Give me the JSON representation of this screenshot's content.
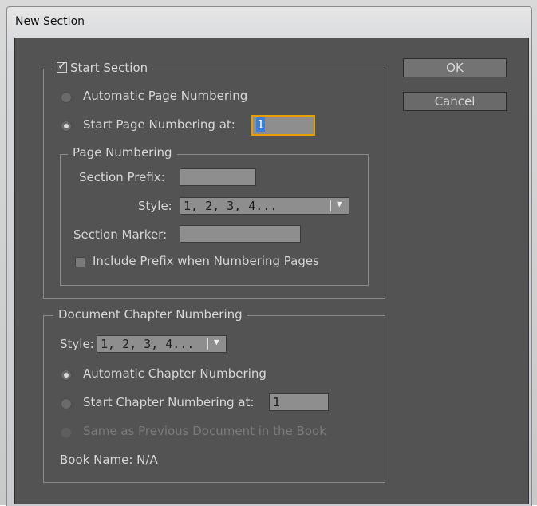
{
  "window": {
    "title": "New Section"
  },
  "start_section": {
    "label": "Start Section",
    "checked": true
  },
  "page_numbering_mode": {
    "automatic_label": "Automatic Page Numbering",
    "start_at_label": "Start Page Numbering at:",
    "start_at_value": "1",
    "selected": "start_at"
  },
  "page_numbering": {
    "group_label": "Page Numbering",
    "section_prefix_label": "Section Prefix:",
    "section_prefix_value": "",
    "style_label": "Style:",
    "style_value": "1, 2, 3, 4...",
    "section_marker_label": "Section Marker:",
    "section_marker_value": "",
    "include_prefix_label": "Include Prefix when Numbering Pages",
    "include_prefix_checked": false
  },
  "chapter_numbering": {
    "group_label": "Document Chapter Numbering",
    "style_label": "Style:",
    "style_value": "1, 2, 3, 4...",
    "automatic_label": "Automatic Chapter Numbering",
    "start_at_label": "Start Chapter Numbering at:",
    "start_at_value": "1",
    "same_as_previous_label": "Same as Previous Document in the Book",
    "book_name_label": "Book Name: N/A",
    "selected": "automatic"
  },
  "buttons": {
    "ok": "OK",
    "cancel": "Cancel"
  },
  "colors": {
    "panel": "#535353",
    "focus_border": "#e6a000",
    "selection": "#3b7fd6"
  }
}
